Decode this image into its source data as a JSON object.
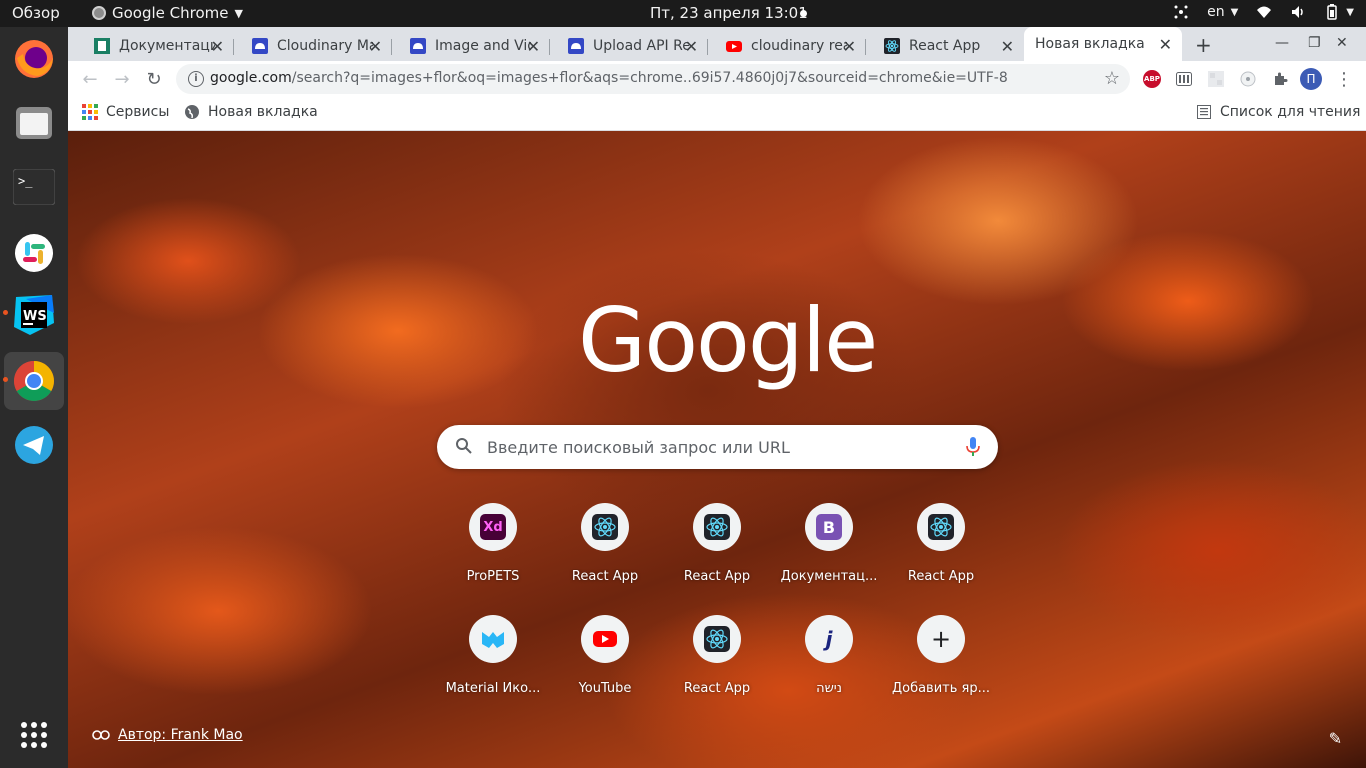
{
  "topbar": {
    "activities": "Обзор",
    "app_name": "Google Chrome",
    "clock": "Пт, 23 апреля  13:01",
    "lang": "en"
  },
  "dock": {
    "items": [
      "Firefox",
      "Files",
      "Terminal",
      "Slack",
      "WebStorm",
      "Chrome",
      "Telegram",
      "Show Applications"
    ]
  },
  "tabs": [
    {
      "title": "Документация",
      "icon": "doc-icon"
    },
    {
      "title": "Cloudinary Ma",
      "icon": "cloudinary-icon"
    },
    {
      "title": "Image and Vid",
      "icon": "cloudinary-icon"
    },
    {
      "title": "Upload API Re",
      "icon": "cloudinary-icon"
    },
    {
      "title": "cloudinary rea",
      "icon": "youtube-icon"
    },
    {
      "title": "React App",
      "icon": "react-icon"
    },
    {
      "title": "Новая вкладка",
      "icon": "none",
      "active": true
    }
  ],
  "omnibox": {
    "host": "google.com",
    "path": "/search?q=images+flor&oq=images+flor&aqs=chrome..69i57.4860j0j7&sourceid=chrome&ie=UTF-8"
  },
  "bookmarks": {
    "apps": "Сервисы",
    "new_tab": "Новая вкладка",
    "reading_list": "Список для чтения"
  },
  "ntp": {
    "logo": "Google",
    "search_placeholder": "Введите поисковый запрос или URL",
    "shortcuts": [
      {
        "label": "ProPETS",
        "icon": "xd-icon"
      },
      {
        "label": "React App",
        "icon": "react-icon"
      },
      {
        "label": "React App",
        "icon": "react-icon"
      },
      {
        "label": "Документац...",
        "icon": "bootstrap-icon"
      },
      {
        "label": "React App",
        "icon": "react-icon"
      },
      {
        "label": "Material Ико...",
        "icon": "material-icon"
      },
      {
        "label": "YouTube",
        "icon": "youtube-icon"
      },
      {
        "label": "React App",
        "icon": "react-icon"
      },
      {
        "label": "נישה",
        "icon": "j-icon"
      },
      {
        "label": "Добавить яр...",
        "icon": "plus-icon"
      }
    ],
    "author_prefix": "Автор: Frank Mao"
  },
  "colors": {
    "accent_ubuntu": "#e95420",
    "chrome_tabstrip": "#dee1e6",
    "react": "#61dafb"
  }
}
